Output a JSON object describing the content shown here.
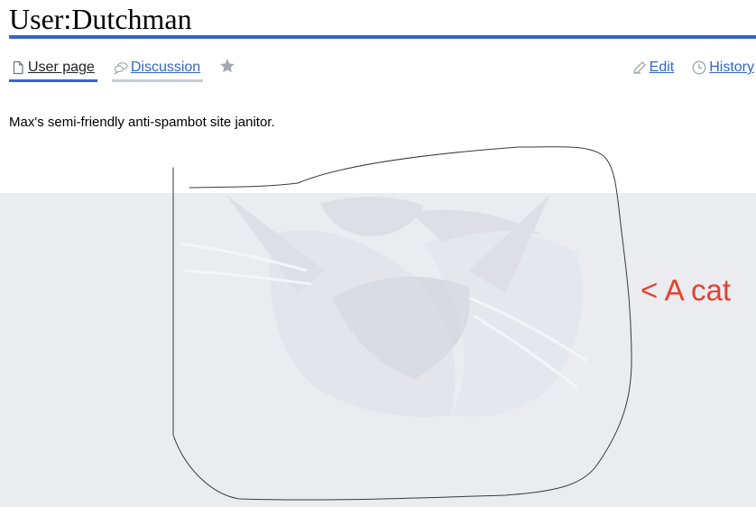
{
  "page": {
    "title": "User:Dutchman",
    "tagline": "Max's semi-friendly anti-spambot site janitor."
  },
  "tabs": {
    "user_page": "User page",
    "discussion": "Discussion"
  },
  "actions": {
    "edit": "Edit",
    "history": "History"
  },
  "annotation": {
    "label": "< A cat",
    "color": "#e8412c"
  },
  "colors": {
    "accent": "#3366cc",
    "banner_bg": "#eaecf0",
    "tab_inactive_rule": "#c8ccd1",
    "star": "#a2a9b1"
  },
  "icons": {
    "user_page": "page-icon",
    "discussion": "speech-bubbles-icon",
    "watch": "star-icon",
    "edit": "pencil-icon",
    "history": "clock-icon"
  }
}
